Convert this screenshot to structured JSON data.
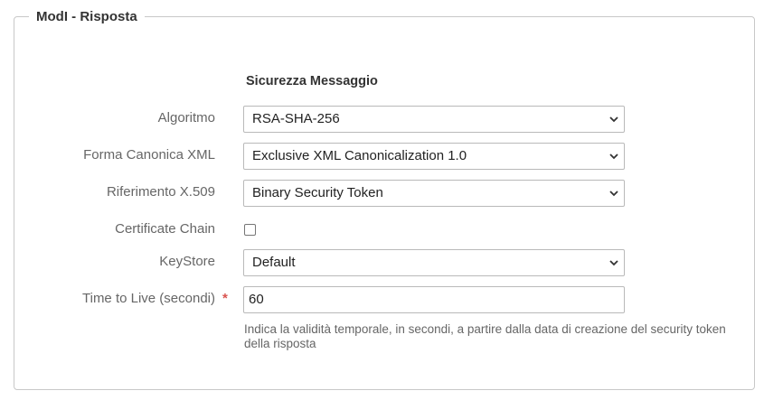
{
  "fieldset": {
    "legend": "ModI - Risposta"
  },
  "section": {
    "title": "Sicurezza Messaggio"
  },
  "fields": {
    "algoritmo": {
      "label": "Algoritmo",
      "value": "RSA-SHA-256"
    },
    "forma_canonica": {
      "label": "Forma Canonica XML",
      "value": "Exclusive XML Canonicalization 1.0"
    },
    "riferimento": {
      "label": "Riferimento X.509",
      "value": "Binary Security Token"
    },
    "certificate_chain": {
      "label": "Certificate Chain",
      "checked": false
    },
    "keystore": {
      "label": "KeyStore",
      "value": "Default"
    },
    "ttl": {
      "label": "Time to Live (secondi)",
      "required_marker": "*",
      "value": "60",
      "help_text": "Indica la validità temporale, in secondi, a partire dalla data di creazione del security token della risposta"
    }
  },
  "colors": {
    "required": "#d9534f",
    "label": "#666666",
    "border": "#b9b9b9"
  },
  "icons": {
    "select_arrow": "chevron-down-icon"
  }
}
